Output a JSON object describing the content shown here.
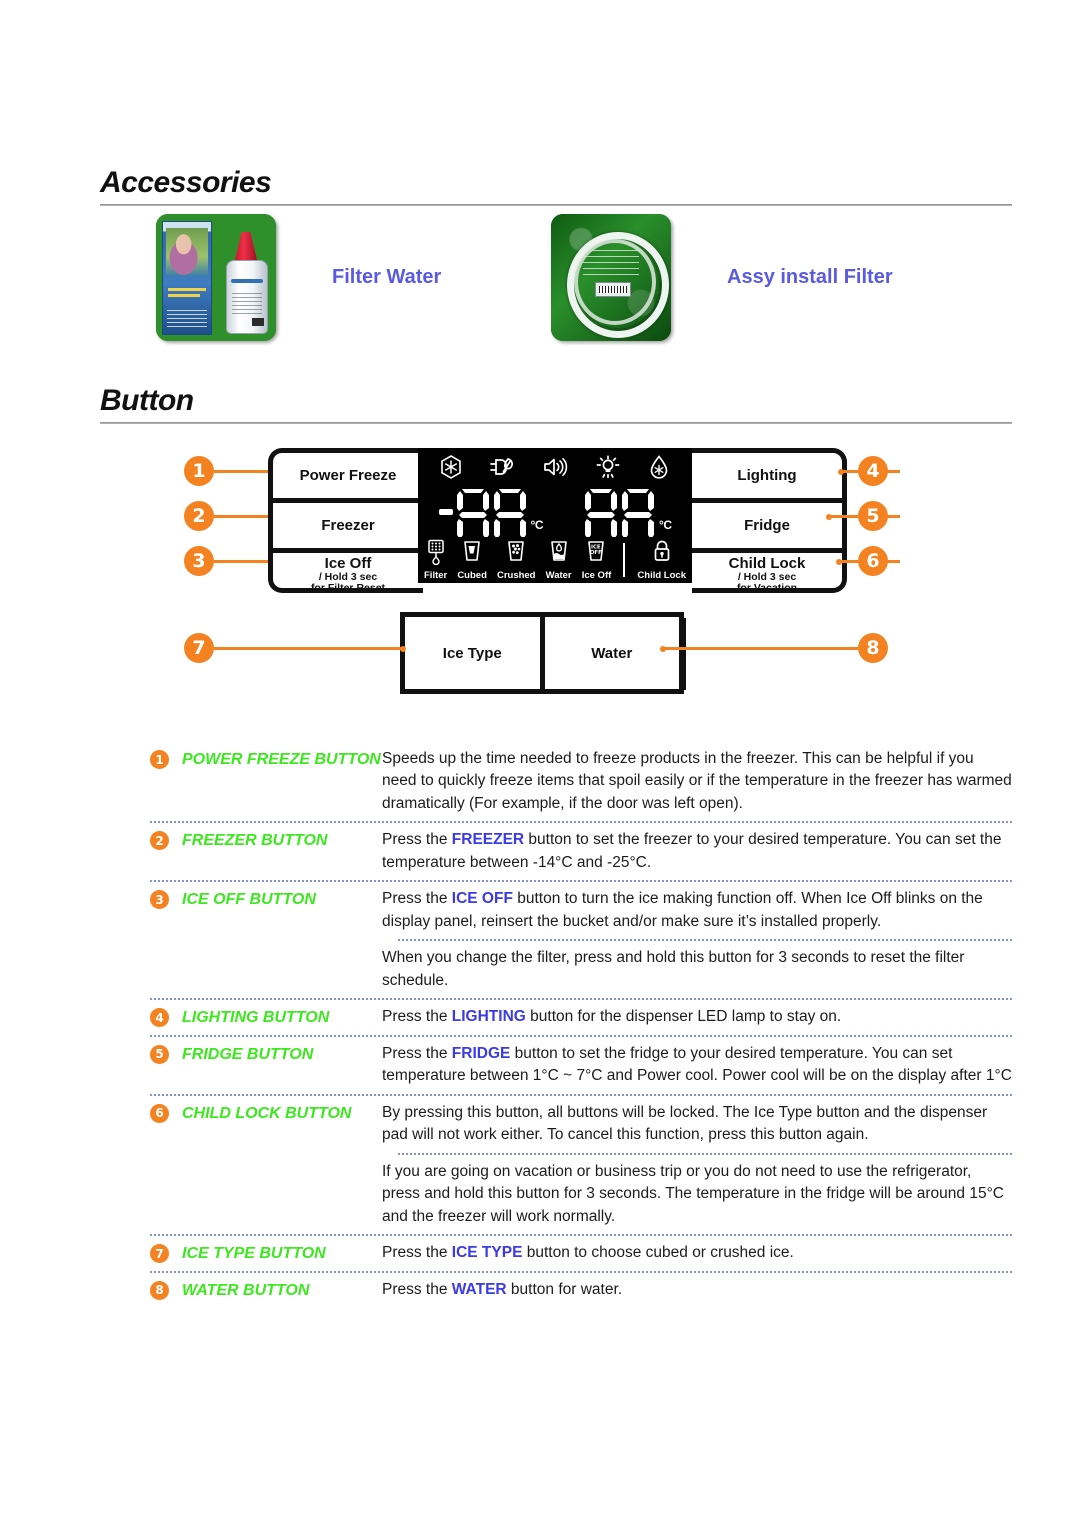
{
  "colors": {
    "orange": "#F58220",
    "green": "#3CE81E",
    "blue_bold": "#3A3AE6",
    "link_blue": "#5A5AE0",
    "lcd_bg": "#000000"
  },
  "sections": {
    "accessories": {
      "title": "Accessories"
    },
    "button": {
      "title": "Button"
    }
  },
  "accessories": [
    {
      "label": "Filter Water",
      "icon": "water-filter-cartridge-image"
    },
    {
      "label": "Assy install Filter",
      "icon": "filter-install-tubing-image"
    }
  ],
  "panel": {
    "left_buttons": [
      {
        "main": "Power Freeze",
        "sub1": "",
        "sub2": ""
      },
      {
        "main": "Freezer",
        "sub1": "",
        "sub2": ""
      },
      {
        "main": "Ice Off",
        "sub1": "/ Hold 3 sec",
        "sub2": "for Filter Reset"
      }
    ],
    "right_buttons": [
      {
        "main": "Lighting",
        "sub1": "",
        "sub2": ""
      },
      {
        "main": "Fridge",
        "sub1": "",
        "sub2": ""
      },
      {
        "main": "Child Lock",
        "sub1": "/ Hold 3 sec",
        "sub2": "for Vacation"
      }
    ],
    "callouts": {
      "left": [
        "1",
        "2",
        "3"
      ],
      "right": [
        "4",
        "5",
        "6"
      ],
      "dispenser_left": "7",
      "dispenser_right": "8"
    },
    "display": {
      "top_icons": [
        "power-freeze-snowflake-icon",
        "energy-saving-plug-icon",
        "sound-speaker-icon",
        "lamp-lighting-icon",
        "power-cool-droplet-icon"
      ],
      "freezer_temp": "-88",
      "freezer_unit": "°C",
      "fridge_temp": "88",
      "fridge_unit": "°C",
      "bottom_icons": [
        {
          "caption": "Filter",
          "icon": "filter-icon"
        },
        {
          "caption": "Cubed",
          "icon": "cubed-ice-glass-icon"
        },
        {
          "caption": "Crushed",
          "icon": "crushed-ice-glass-icon"
        },
        {
          "caption": "Water",
          "icon": "water-glass-icon"
        },
        {
          "caption": "Ice Off",
          "icon": "ice-off-glass-icon"
        },
        {
          "caption": "Child Lock",
          "icon": "padlock-icon"
        }
      ]
    },
    "dispenser_pads": [
      {
        "label": "Ice Type"
      },
      {
        "label": "Water"
      }
    ]
  },
  "descriptions": [
    {
      "num": "1",
      "term": "POWER FREEZE BUTTON",
      "body_html": "Speeds up the time needed to freeze products in the freezer. This can be helpful if you need to quickly freeze items that spoil easily or if the temperature in the freezer has warmed dramatically (For example, if the door was left open)."
    },
    {
      "num": "2",
      "term": "FREEZER BUTTON",
      "body_html": "Press the <b>FREEZER</b> button to set the freezer to your desired temperature. You can set the temperature between -14°C and -25°C."
    },
    {
      "num": "3",
      "term": "ICE OFF BUTTON",
      "body_html": "Press the <b>ICE OFF</b> button to turn the ice making function off. When Ice Off blinks on the display panel, reinsert the bucket and/or make sure it’s installed properly."
    },
    {
      "num": "",
      "term": "",
      "body_html": "When you change the filter, press and hold this button for 3 seconds to reset the filter schedule."
    },
    {
      "num": "4",
      "term": "LIGHTING BUTTON",
      "body_html": "Press the <b>LIGHTING</b> button for the dispenser LED lamp to stay on."
    },
    {
      "num": "5",
      "term": "FRIDGE BUTTON",
      "body_html": "Press the <b>FRIDGE</b> button to set the fridge to your desired temperature. You can set temperature between 1°C ~ 7°C and Power cool. Power cool will be on the display after 1°C"
    },
    {
      "num": "6",
      "term": "CHILD LOCK BUTTON",
      "body_html": "By pressing this button, all buttons will be locked. The Ice Type button and the dispenser pad will not work either. To cancel this function, press this button again."
    },
    {
      "num": "",
      "term": "",
      "body_html": "If you are going on vacation or business trip or you do not need to use the refrigerator, press and hold this button for 3 seconds. The temperature in the fridge will be around 15°C and the freezer will work normally."
    },
    {
      "num": "7",
      "term": "ICE TYPE BUTTON",
      "body_html": "Press the <b>ICE TYPE</b> button to choose cubed or crushed ice."
    },
    {
      "num": "8",
      "term": "WATER BUTTON",
      "body_html": "Press the <b>WATER</b> button for water."
    }
  ]
}
